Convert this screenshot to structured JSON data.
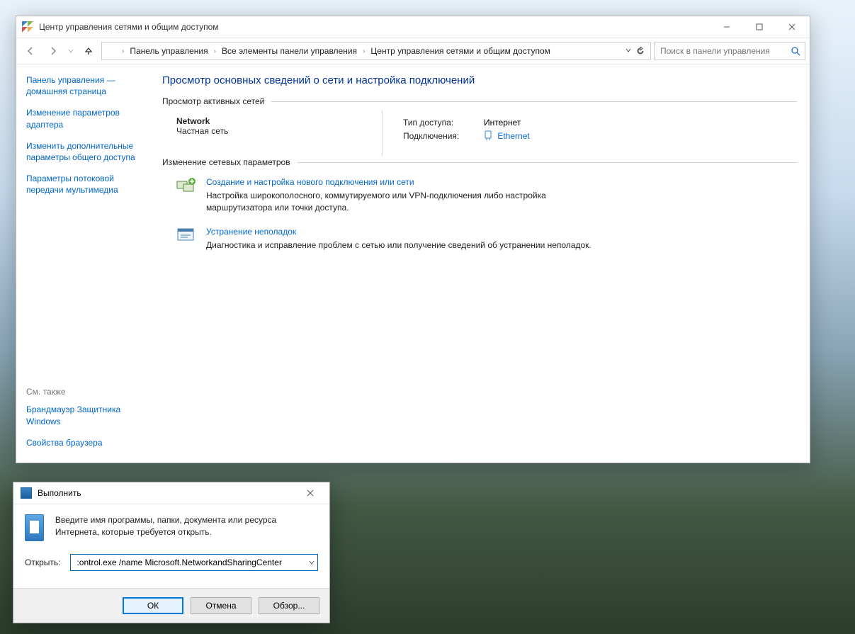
{
  "mainWindow": {
    "title": "Центр управления сетями и общим доступом",
    "breadcrumb": {
      "seg1": "Панель управления",
      "seg2": "Все элементы панели управления",
      "seg3": "Центр управления сетями и общим доступом"
    },
    "search_placeholder": "Поиск в панели управления",
    "sidebar": {
      "link1": "Панель управления — домашняя страница",
      "link2": "Изменение параметров адаптера",
      "link3": "Изменить дополнительные параметры общего доступа",
      "link4": "Параметры потоковой передачи мультимедиа",
      "see_also_label": "См. также",
      "see1": "Брандмауэр Защитника Windows",
      "see2": "Свойства браузера"
    },
    "content": {
      "page_title": "Просмотр основных сведений о сети и настройка подключений",
      "active_nets_label": "Просмотр активных сетей",
      "network_name": "Network",
      "network_type": "Частная сеть",
      "access_label": "Тип доступа:",
      "access_value": "Интернет",
      "conn_label": "Подключения:",
      "conn_value": "Ethernet",
      "change_params_label": "Изменение сетевых параметров",
      "task1": {
        "link": "Создание и настройка нового подключения или сети",
        "desc": "Настройка широкополосного, коммутируемого или VPN-подключения либо настройка маршрутизатора или точки доступа."
      },
      "task2": {
        "link": "Устранение неполадок",
        "desc": "Диагностика и исправление проблем с сетью или получение сведений об устранении неполадок."
      }
    }
  },
  "runDialog": {
    "title": "Выполнить",
    "message": "Введите имя программы, папки, документа или ресурса Интернета, которые требуется открыть.",
    "open_label": "Открыть:",
    "open_value": ":ontrol.exe /name Microsoft.NetworkandSharingCenter",
    "btn_ok": "ОК",
    "btn_cancel": "Отмена",
    "btn_browse": "Обзор..."
  }
}
